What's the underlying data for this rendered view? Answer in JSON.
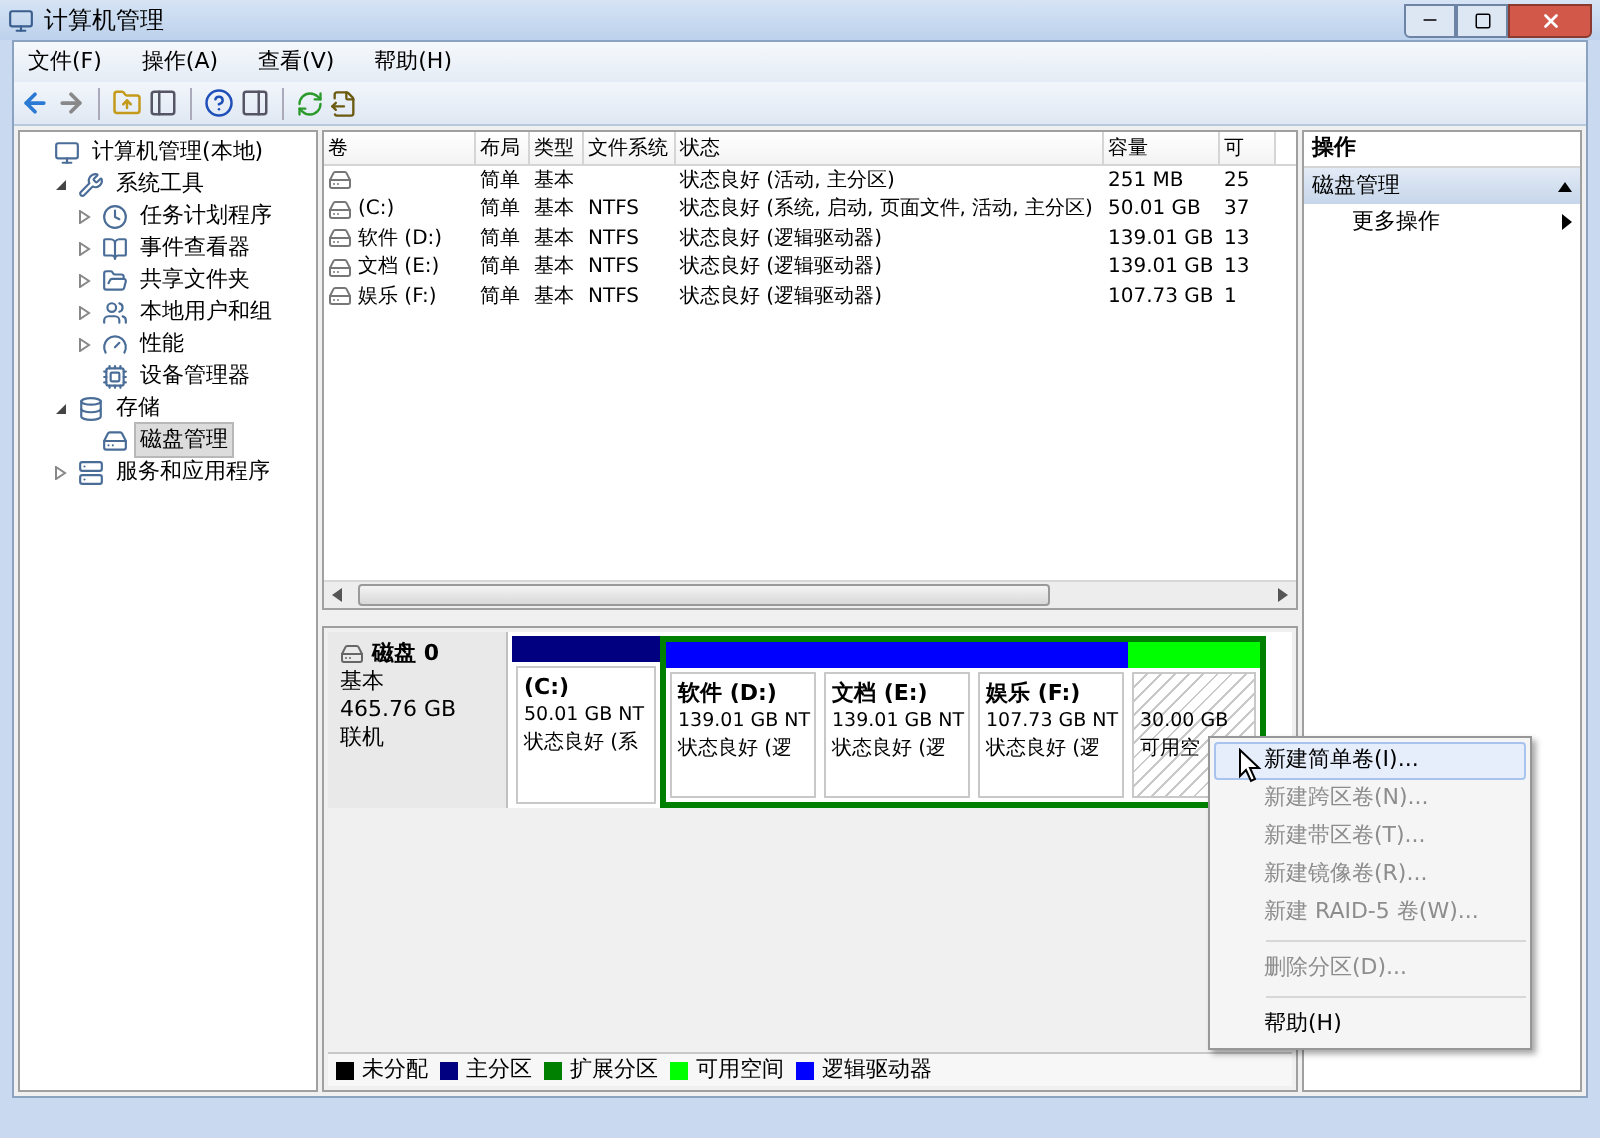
{
  "window": {
    "title": "计算机管理"
  },
  "menu": [
    "文件(F)",
    "操作(A)",
    "查看(V)",
    "帮助(H)"
  ],
  "tree": [
    {
      "label": "计算机管理(本地)",
      "selected": false,
      "children": [
        {
          "label": "系统工具",
          "expanded": true,
          "selected": false,
          "children": [
            {
              "label": "任务计划程序",
              "expanded": false,
              "selected": false
            },
            {
              "label": "事件查看器",
              "expanded": false,
              "selected": false
            },
            {
              "label": "共享文件夹",
              "expanded": false,
              "selected": false
            },
            {
              "label": "本地用户和组",
              "expanded": false,
              "selected": false
            },
            {
              "label": "性能",
              "expanded": false,
              "selected": false
            },
            {
              "label": "设备管理器",
              "selected": false
            }
          ]
        },
        {
          "label": "存储",
          "expanded": true,
          "selected": false,
          "children": [
            {
              "label": "磁盘管理",
              "selected": true
            }
          ]
        },
        {
          "label": "服务和应用程序",
          "expanded": false,
          "selected": false
        }
      ]
    }
  ],
  "table": {
    "columns": [
      "卷",
      "布局",
      "类型",
      "文件系统",
      "状态",
      "容量",
      "可"
    ],
    "rows": [
      [
        "",
        "简单",
        "基本",
        "",
        "状态良好 (活动, 主分区)",
        "251 MB",
        "25"
      ],
      [
        "(C:)",
        "简单",
        "基本",
        "NTFS",
        "状态良好 (系统, 启动, 页面文件, 活动, 主分区)",
        "50.01 GB",
        "37"
      ],
      [
        "软件 (D:)",
        "简单",
        "基本",
        "NTFS",
        "状态良好 (逻辑驱动器)",
        "139.01 GB",
        "13"
      ],
      [
        "文档 (E:)",
        "简单",
        "基本",
        "NTFS",
        "状态良好 (逻辑驱动器)",
        "139.01 GB",
        "13"
      ],
      [
        "娱乐 (F:)",
        "简单",
        "基本",
        "NTFS",
        "状态良好 (逻辑驱动器)",
        "107.73 GB",
        "1"
      ]
    ]
  },
  "disk": {
    "name": "磁盘 0",
    "type": "基本",
    "size": "465.76 GB",
    "status": "联机",
    "partitions": [
      {
        "kind": "primary",
        "selected": false,
        "name": "(C:)",
        "size": "50.01 GB NT",
        "status": "状态良好 (系"
      },
      {
        "kind": "extended",
        "children": [
          {
            "kind": "logical",
            "selected": false,
            "name": "软件 (D:)",
            "size": "139.01 GB NT",
            "status": "状态良好 (逻"
          },
          {
            "kind": "logical",
            "selected": false,
            "name": "文档 (E:)",
            "size": "139.01 GB NT",
            "status": "状态良好 (逻"
          },
          {
            "kind": "logical",
            "selected": false,
            "name": "娱乐 (F:)",
            "size": "107.73 GB NT",
            "status": "状态良好 (逻"
          },
          {
            "kind": "free",
            "selected": true,
            "size": "30.00 GB",
            "status": "可用空"
          }
        ]
      }
    ]
  },
  "legend": [
    {
      "label": "未分配",
      "color": "#000000"
    },
    {
      "label": "主分区",
      "color": "#000080"
    },
    {
      "label": "扩展分区",
      "color": "#008000"
    },
    {
      "label": "可用空间",
      "color": "#00ff00"
    },
    {
      "label": "逻辑驱动器",
      "color": "#0000ff"
    }
  ],
  "actions": {
    "title": "操作",
    "section": {
      "label": "磁盘管理",
      "expanded": true
    },
    "items": [
      "更多操作"
    ]
  },
  "context_menu": [
    {
      "kind": "item",
      "label": "新建简单卷(I)...",
      "disabled": false,
      "selected": true
    },
    {
      "kind": "item",
      "label": "新建跨区卷(N)...",
      "disabled": true,
      "selected": false
    },
    {
      "kind": "item",
      "label": "新建带区卷(T)...",
      "disabled": true,
      "selected": false
    },
    {
      "kind": "item",
      "label": "新建镜像卷(R)...",
      "disabled": true,
      "selected": false
    },
    {
      "kind": "item",
      "label": "新建 RAID-5 卷(W)...",
      "disabled": true,
      "selected": false
    },
    {
      "kind": "separator"
    },
    {
      "kind": "item",
      "label": "删除分区(D)...",
      "disabled": true,
      "selected": false
    },
    {
      "kind": "separator"
    },
    {
      "kind": "item",
      "label": "帮助(H)",
      "disabled": false,
      "selected": false
    }
  ]
}
